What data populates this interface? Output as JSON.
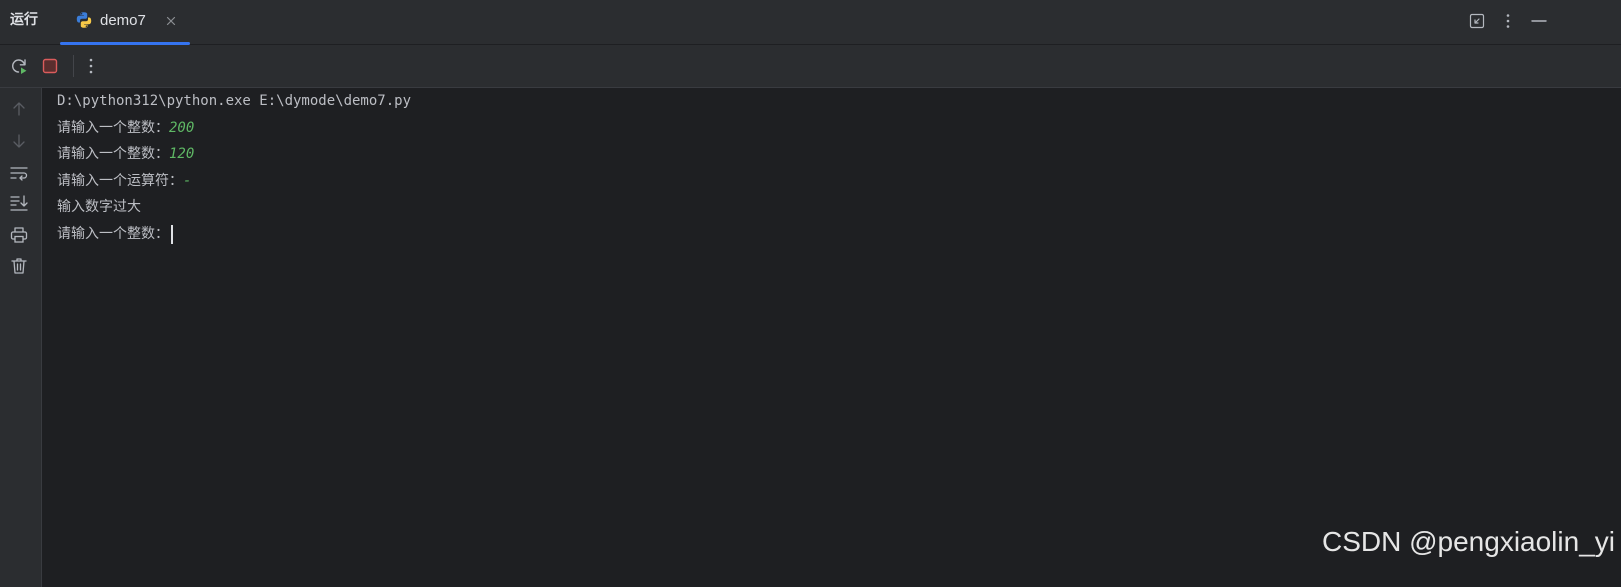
{
  "header": {
    "panel_title": "运行",
    "tab": {
      "label": "demo7",
      "icon": "python-icon",
      "active": true
    },
    "buttons": [
      "restore-window-icon",
      "more-vertical-icon",
      "minimize-icon"
    ]
  },
  "toolbar": {
    "buttons": [
      "rerun-icon",
      "stop-icon",
      "more-vertical-icon"
    ],
    "colors": {
      "accent": "#3574f0",
      "stop": "#db5c5c",
      "rerun_play": "#5fb865"
    }
  },
  "gutter": {
    "buttons": [
      "arrow-up-icon",
      "arrow-down-icon",
      "soft-wrap-icon",
      "scroll-to-end-icon",
      "print-icon",
      "trash-icon"
    ]
  },
  "console": {
    "command": "D:\\python312\\python.exe E:\\dymode\\demo7.py",
    "lines": [
      {
        "prompt": "请输入一个整数：",
        "input": "200"
      },
      {
        "prompt": "请输入一个整数：",
        "input": "120"
      },
      {
        "prompt": "请输入一个运算符：",
        "input": "-"
      },
      {
        "prompt": "输入数字过大",
        "input": ""
      },
      {
        "prompt": "请输入一个整数：",
        "input": ""
      }
    ],
    "colors": {
      "text": "#bcbec4",
      "user_input": "#5fb865",
      "background": "#1e1f22"
    }
  },
  "watermark": "CSDN @pengxiaolin_yi"
}
